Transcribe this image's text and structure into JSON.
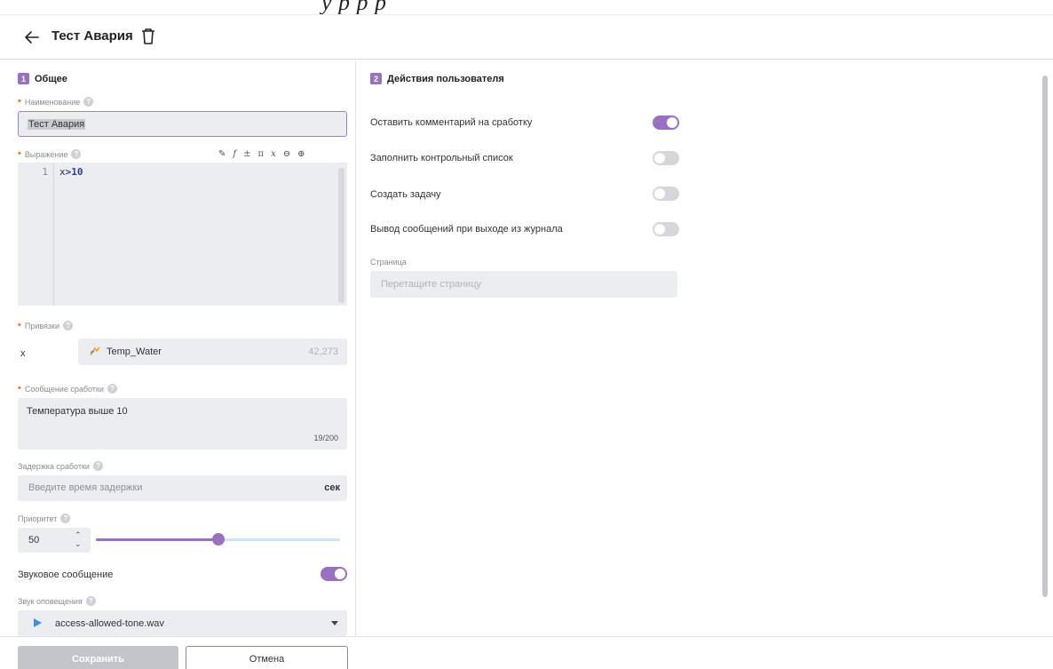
{
  "top_strip": {
    "text": "у                                р          р          р"
  },
  "header": {
    "title": "Тест Авария",
    "back_icon": "arrow-left-icon",
    "delete_icon": "trash-icon"
  },
  "general": {
    "badge": "1",
    "title": "Общее",
    "name": {
      "label": "Наименование",
      "value": "Тест Авария"
    },
    "expression": {
      "label": "Выражение",
      "tools": [
        "✎",
        "f",
        "±",
        "π",
        "x",
        "⊖",
        "⊕"
      ],
      "line_number": "1",
      "code_var": "x",
      "code_rest": ">10"
    },
    "bindings": {
      "label": "Привязки",
      "var": "x",
      "tag": "Temp_Water",
      "value": "42,273"
    },
    "message": {
      "label": "Сообщение сработки",
      "value": "Температура выше 10",
      "counter": "19/200"
    },
    "delay": {
      "label": "Задержка сработки",
      "placeholder": "Введите время задержки",
      "unit": "сек"
    },
    "priority": {
      "label": "Приоритет",
      "value": "50",
      "stepper": "⌃⌄",
      "slider_fraction": 0.5
    },
    "sound_message": {
      "label": "Звуковое сообщение",
      "enabled": true
    },
    "sound": {
      "label": "Звук оповещения",
      "file": "access-allowed-tone.wav"
    }
  },
  "actions": {
    "badge": "2",
    "title": "Действия пользователя",
    "items": [
      {
        "label": "Оставить комментарий на сработку",
        "enabled": true
      },
      {
        "label": "Заполнить контрольный список",
        "enabled": false
      },
      {
        "label": "Создать задачу",
        "enabled": false
      },
      {
        "label": "Вывод сообщений при выходе из журнала",
        "enabled": false
      }
    ],
    "page": {
      "label": "Страница",
      "placeholder": "Перетащите страницу"
    }
  },
  "footer": {
    "save": "Сохранить",
    "cancel": "Отмена"
  },
  "colors": {
    "accent": "#9872c0",
    "required": "#ef7a22",
    "field_bg": "#ecedf1",
    "play": "#3d8fe0"
  }
}
